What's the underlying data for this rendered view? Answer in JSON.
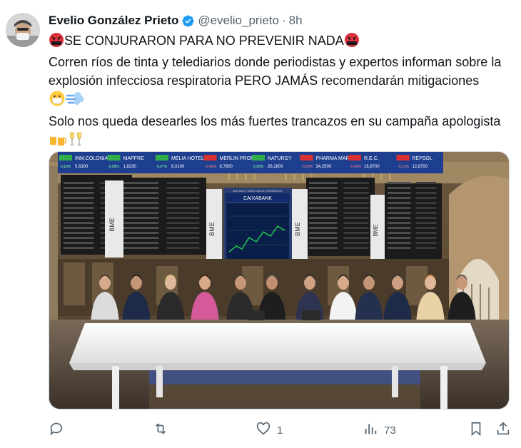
{
  "author": {
    "name": "Evelio González Prieto",
    "handle": "@evelio_prieto",
    "separator": "·",
    "time": "8h"
  },
  "tweet": {
    "line1": "SE CONJURARON PARA NO PREVENIR NADA",
    "line2": "Corren ríos de tinta y telediarios donde periodistas y expertos informan sobre la explosión infecciosa respiratoria PERO JAMÁS recomendarán mitigaciones",
    "line3": "Solo nos queda desearles los más fuertes trancazos en su campaña apologista"
  },
  "media": {
    "ticker_labels": [
      "INM.COLONIAL",
      "MAPFRE",
      "MELIA HOTELS",
      "MERLIN PROP.",
      "NATURGY",
      "PHARMA MAR",
      "R.E.C.",
      "REPSOL"
    ],
    "ticker_values": [
      "5,6300",
      "1,8230",
      "6,0100",
      "8,7800",
      "26,2800",
      "34,2500",
      "16,9700",
      "12,8700"
    ],
    "ticker_changes": [
      "0,18%",
      "0,58%",
      "0,07%",
      "-0,68%",
      "0,58%",
      "-0,12%",
      "-0,43%",
      "-0,11%"
    ],
    "bank_label": "CAIXABANK",
    "board_label": "BOLSAS Y MERCADOS ESPAÑOLES",
    "bme_logo": "BME"
  },
  "actions": {
    "reply_count": "",
    "retweet_count": "",
    "like_count": "1",
    "views_count": "73"
  },
  "colors": {
    "verified": "#1d9bf0",
    "secondary_text": "#536471",
    "ticker_blue": "#1e3f8f",
    "led_green": "#27d452"
  }
}
